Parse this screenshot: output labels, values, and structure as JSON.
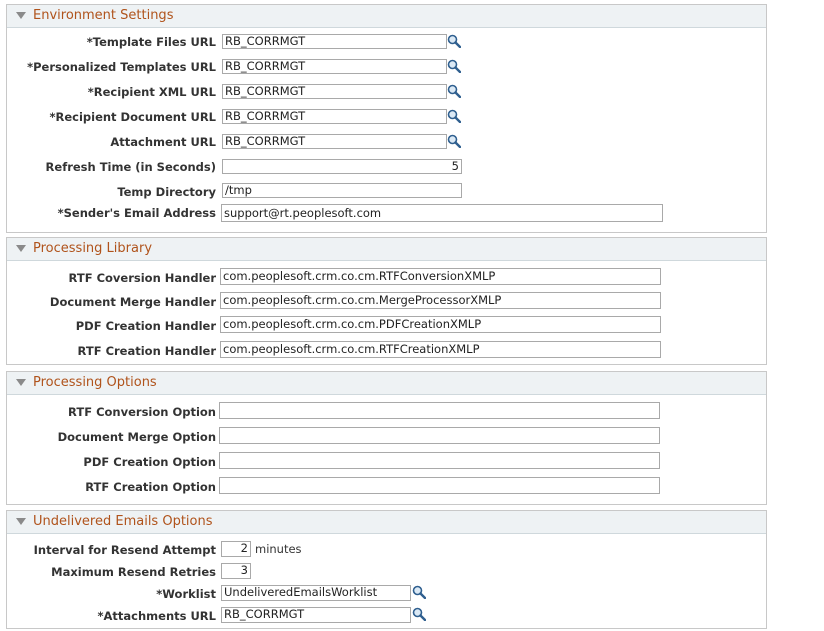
{
  "environment": {
    "title": "Environment Settings",
    "fields": [
      {
        "label": "*Template Files URL",
        "value": "RB_CORRMGT",
        "lookup": true
      },
      {
        "label": "*Personalized Templates URL",
        "value": "RB_CORRMGT",
        "lookup": true
      },
      {
        "label": "*Recipient XML URL",
        "value": "RB_CORRMGT",
        "lookup": true
      },
      {
        "label": "*Recipient Document URL",
        "value": "RB_CORRMGT",
        "lookup": true
      },
      {
        "label": "Attachment URL",
        "value": "RB_CORRMGT",
        "lookup": true
      },
      {
        "label": "Refresh Time (in Seconds)",
        "value": "5"
      },
      {
        "label": "Temp Directory",
        "value": "/tmp"
      },
      {
        "label": "*Sender's Email Address",
        "value": "support@rt.peoplesoft.com"
      }
    ]
  },
  "library": {
    "title": "Processing Library",
    "fields": [
      {
        "label": "RTF Coversion Handler",
        "value": "com.peoplesoft.crm.co.cm.RTFConversionXMLP"
      },
      {
        "label": "Document Merge Handler",
        "value": "com.peoplesoft.crm.co.cm.MergeProcessorXMLP"
      },
      {
        "label": "PDF Creation Handler",
        "value": "com.peoplesoft.crm.co.cm.PDFCreationXMLP"
      },
      {
        "label": "RTF Creation Handler",
        "value": "com.peoplesoft.crm.co.cm.RTFCreationXMLP"
      }
    ]
  },
  "options": {
    "title": "Processing Options",
    "fields": [
      {
        "label": "RTF Conversion Option",
        "value": ""
      },
      {
        "label": "Document Merge Option",
        "value": ""
      },
      {
        "label": "PDF Creation Option",
        "value": ""
      },
      {
        "label": "RTF Creation Option",
        "value": ""
      }
    ]
  },
  "undelivered": {
    "title": "Undelivered Emails Options",
    "fields": [
      {
        "label": "Interval for Resend Attempt",
        "value": "2",
        "unit": "minutes"
      },
      {
        "label": "Maximum Resend Retries",
        "value": "3"
      },
      {
        "label": "*Worklist",
        "value": "UndeliveredEmailsWorklist",
        "lookup": true
      },
      {
        "label": "*Attachments URL",
        "value": "RB_CORRMGT",
        "lookup": true
      }
    ]
  },
  "colors": {
    "section_title": "#b0531b",
    "header_bg": "#eef2f4",
    "border": "#c8c8c8"
  }
}
